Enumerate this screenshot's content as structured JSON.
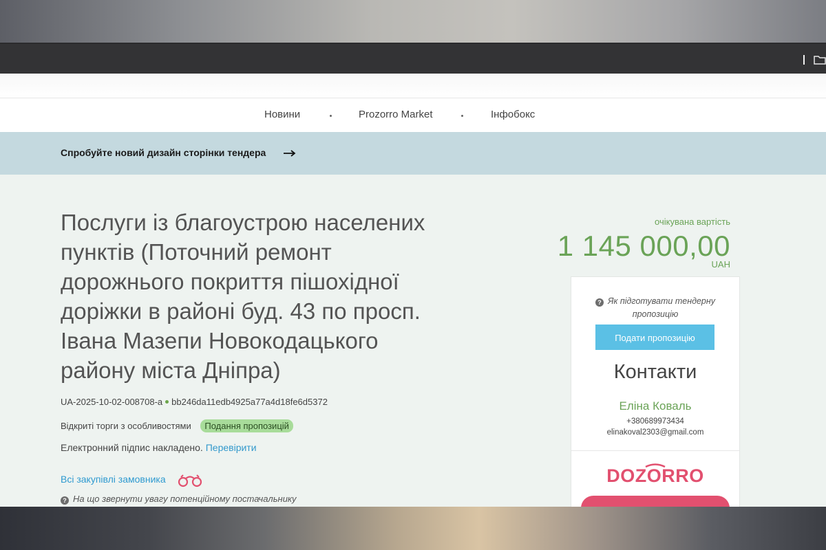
{
  "nav": {
    "items": [
      "Новини",
      "Prozorro Market",
      "Інфобокс"
    ]
  },
  "banner": {
    "text": "Спробуйте новий дизайн сторінки тендера"
  },
  "tender": {
    "title": "Послуги із благоустрою населених пунктів (Поточний ремонт дорожнього покриття пішохідної доріжки в районі буд. 43 по просп. Івана Мазепи Новокодацького району міста Дніпра)",
    "id": "UA-2025-10-02-008708-a",
    "hash": "bb246da11edb4925a77a4d18fe6d5372",
    "procedure": "Відкриті торги з особливостями",
    "status_badge": "Подання пропозицій",
    "signature_text": "Електронний підпис накладено.",
    "verify_link": "Перевірити",
    "all_purchases_link": "Всі закупівлі замовника",
    "attention_text": "На що звернути увагу потенційному постачальнику"
  },
  "value": {
    "label": "очікувана вартість",
    "amount": "1 145 000,00",
    "currency": "UAH"
  },
  "sidebar": {
    "how_to_prepare": "Як підготувати тендерну пропозицію",
    "submit_button": "Подати пропозицію",
    "contacts_heading": "Контакти",
    "contact_name": "Еліна Коваль",
    "contact_phone": "+380689973434",
    "contact_email": "elinakoval2303@gmail.com",
    "dozorro_logo_text": "DOZORRO"
  },
  "colors": {
    "accent_green": "#6aa357",
    "link_blue": "#2e9ad0",
    "button_blue": "#5bc0e5",
    "banner_bg": "#c4d9df",
    "dozorro_red": "#e2506f"
  }
}
